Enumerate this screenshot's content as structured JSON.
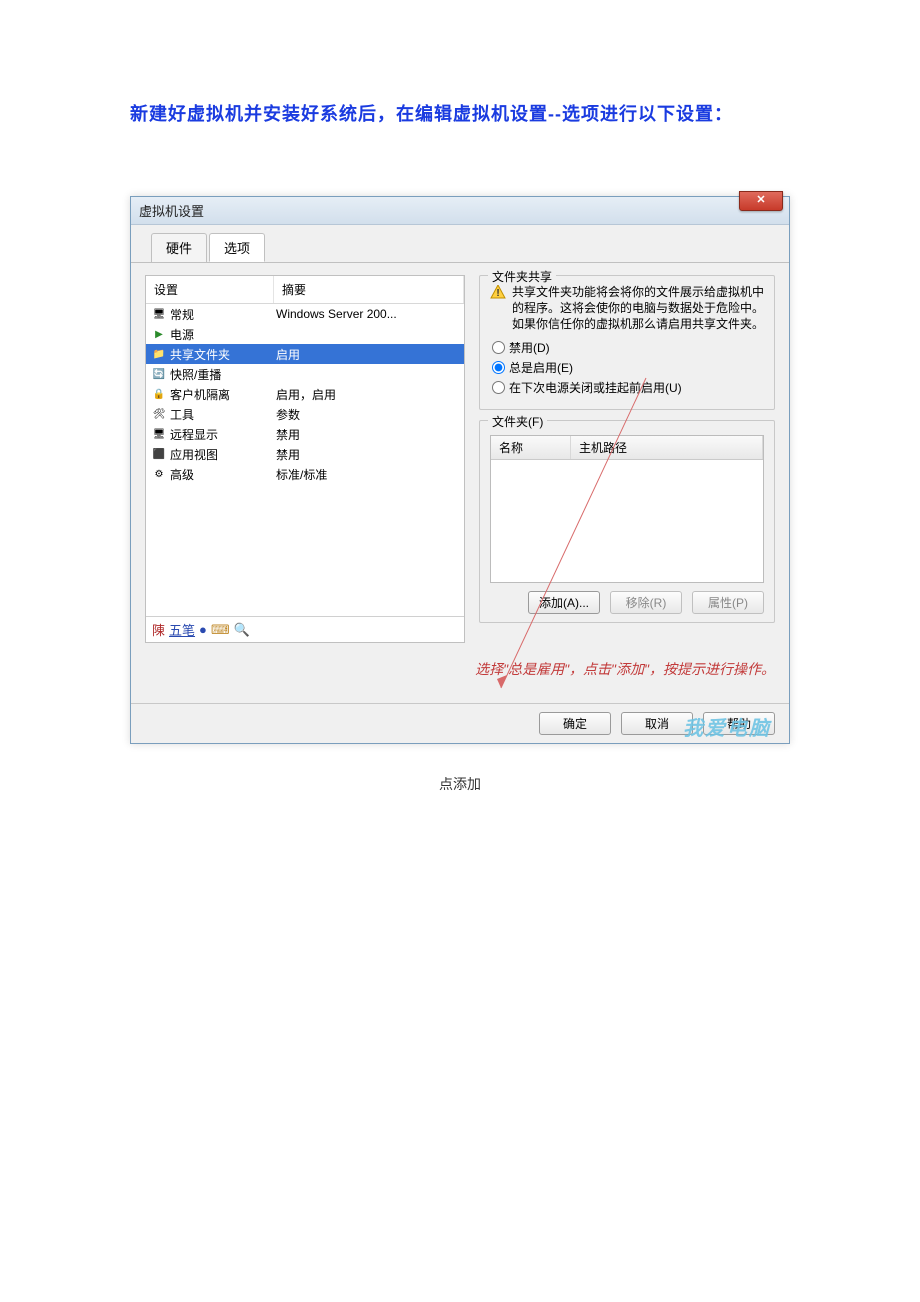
{
  "page": {
    "heading": "新建好虚拟机并安装好系统后，在编辑虚拟机设置--选项进行以下设置：",
    "caption": "点添加"
  },
  "dialog": {
    "title": "虚拟机设置",
    "close": "✕",
    "tabs": {
      "hardware": "硬件",
      "options": "选项"
    },
    "columns": {
      "setting": "设置",
      "summary": "摘要"
    },
    "rows": [
      {
        "icon": "ic-monitor",
        "label": "常规",
        "summary": "Windows Server 200..."
      },
      {
        "icon": "ic-play",
        "label": "电源",
        "summary": ""
      },
      {
        "icon": "ic-folder",
        "label": "共享文件夹",
        "summary": "启用",
        "selected": true
      },
      {
        "icon": "ic-refresh",
        "label": "快照/重播",
        "summary": ""
      },
      {
        "icon": "ic-lock",
        "label": "客户机隔离",
        "summary": "启用，启用"
      },
      {
        "icon": "ic-tools",
        "label": "工具",
        "summary": "参数"
      },
      {
        "icon": "ic-remote",
        "label": "远程显示",
        "summary": "禁用"
      },
      {
        "icon": "ic-app",
        "label": "应用视图",
        "summary": "禁用"
      },
      {
        "icon": "ic-adv",
        "label": "高级",
        "summary": "标准/标准"
      }
    ],
    "ime": {
      "chen": "陳",
      "wubi": "五笔",
      "dot": "●"
    }
  },
  "right": {
    "sharing_title": "文件夹共享",
    "warning": "共享文件夹功能将会将你的文件展示给虚拟机中的程序。这将会使你的电脑与数据处于危险中。如果你信任你的虚拟机那么请启用共享文件夹。",
    "opt_disabled": "禁用(D)",
    "opt_always": "总是启用(E)",
    "opt_until": "在下次电源关闭或挂起前启用(U)",
    "folders_title": "文件夹(F)",
    "col_name": "名称",
    "col_path": "主机路径",
    "btn_add": "添加(A)...",
    "btn_remove": "移除(R)",
    "btn_props": "属性(P)"
  },
  "annotation": "选择\"总是雇用\"，点击\"添加\"，按提示进行操作。",
  "footer": {
    "ok": "确定",
    "cancel": "取消",
    "help": "帮助"
  },
  "watermark": "我爱电脑"
}
